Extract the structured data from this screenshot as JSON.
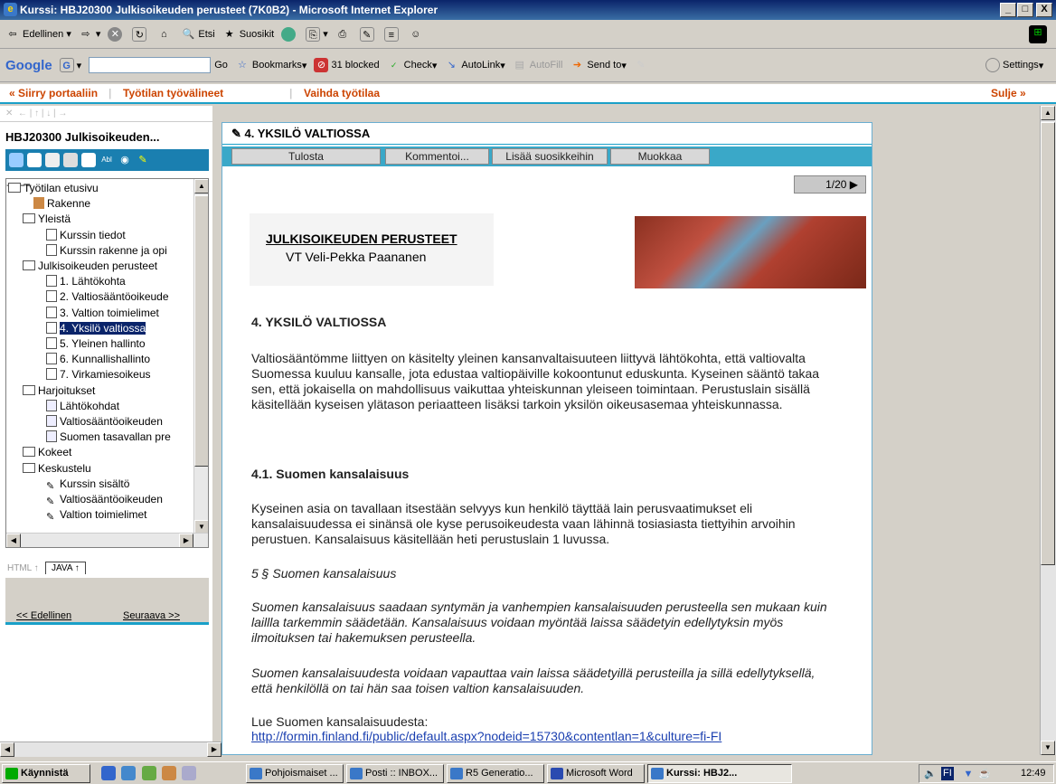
{
  "window": {
    "title": "Kurssi: HBJ20300 Julkisoikeuden perusteet (7K0B2) - Microsoft Internet Explorer",
    "min": "_",
    "max": "□",
    "close": "X"
  },
  "ie_toolbar": {
    "back": "Edellinen",
    "search": "Etsi",
    "favorites": "Suosikit"
  },
  "google_bar": {
    "logo": "Google",
    "go": "Go",
    "bookmarks": "Bookmarks",
    "blocked": "31 blocked",
    "check": "Check",
    "autolink": "AutoLink",
    "autofill": "AutoFill",
    "send": "Send to",
    "settings": "Settings"
  },
  "portal": {
    "back": "« Siirry portaaliin",
    "tools": "Työtilan työvälineet",
    "switch": "Vaihda työtilaa",
    "close": "Sulje »"
  },
  "left": {
    "course": "HBJ20300 Julkisoikeuden...",
    "tree": [
      "Työtilan etusivu",
      "Rakenne",
      "Yleistä",
      "Kurssin tiedot",
      "Kurssin rakenne ja opi",
      "Julkisoikeuden perusteet",
      "1. Lähtökohta",
      "2. Valtiosääntöoikeude",
      "3. Valtion toimielimet",
      "4. Yksilö valtiossa",
      "5. Yleinen hallinto",
      "6. Kunnallishallinto",
      "7. Virkamiesoikeus",
      "Harjoitukset",
      "Lähtökohdat",
      "Valtiosääntöoikeuden",
      "Suomen tasavallan pre",
      "Kokeet",
      "Keskustelu",
      "Kurssin sisältö",
      "Valtiosääntöoikeuden",
      "Valtion toimielimet"
    ],
    "tab_html": "HTML ↑",
    "tab_java": "JAVA ↑",
    "prev": "<< Edellinen",
    "next": "Seuraava >>"
  },
  "content": {
    "heading": "4. YKSILÖ VALTIOSSA",
    "actions": [
      "Tulosta",
      "Kommentoi...",
      "Lisää suosikkeihin",
      "Muokkaa"
    ],
    "pager": "1/20 ▶",
    "banner_title": "JULKISOIKEUDEN PERUSTEET",
    "banner_author": "VT Veli-Pekka Paananen",
    "h1": "4. YKSILÖ VALTIOSSA",
    "p1": "Valtiosääntömme liittyen on käsitelty yleinen kansanvaltaisuuteen liittyvä lähtökohta, että valtiovalta Suomessa kuuluu kansalle, jota edustaa valtiopäiville kokoontunut eduskunta. Kyseinen sääntö takaa sen, että jokaisella on mahdollisuus vaikuttaa yhteiskunnan yleiseen toimintaan. Perustuslain sisällä käsitellään kyseisen ylätason periaatteen lisäksi tarkoin yksilön oikeusasemaa yhteiskunnassa.",
    "h2": "4.1. Suomen kansalaisuus",
    "p2": "Kyseinen asia on tavallaan itsestään selvyys kun henkilö täyttää lain perusvaatimukset eli kansalaisuudessa ei sinänsä ole kyse perusoikeudesta vaan lähinnä tosiasiasta tiettyihin arvoihin perustuen. Kansalaisuus käsitellään heti perustuslain 1 luvussa.",
    "p3": "5 § Suomen kansalaisuus",
    "p4": "Suomen kansalaisuus saadaan syntymän ja vanhempien kansalaisuuden perusteella sen mukaan kuin laillla tarkemmin säädetään. Kansalaisuus voidaan myöntää laissa säädetyin edellytyksin myös ilmoituksen tai hakemuksen perusteella.",
    "p5": "Suomen kansalaisuudesta voidaan vapauttaa vain laissa säädetyillä perusteilla ja sillä edellytyksellä, että henkilöllä on tai hän saa toisen valtion kansalaisuuden.",
    "p6": "Lue Suomen kansalaisuudesta:",
    "link": "http://formin.finland.fi/public/default.aspx?nodeid=15730&contentlan=1&culture=fi-FI"
  },
  "taskbar": {
    "start": "Käynnistä",
    "tasks": [
      "Pohjoismaiset ...",
      "Posti :: INBOX...",
      "R5 Generatio...",
      "Microsoft Word",
      "Kurssi: HBJ2..."
    ],
    "lang": "FI",
    "time": "12:49"
  }
}
